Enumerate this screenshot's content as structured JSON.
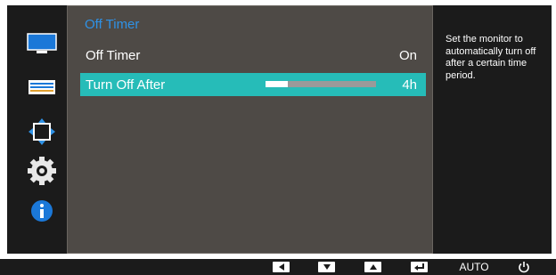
{
  "menu": {
    "title": "Off Timer",
    "rows": [
      {
        "label": "Off Timer",
        "value": "On",
        "selected": false
      },
      {
        "label": "Turn Off After",
        "value": "4h",
        "selected": true,
        "slider_fraction": 0.2
      }
    ]
  },
  "help": {
    "text": "Set the monitor to automatically turn off after a certain time period."
  },
  "sidebar": {
    "items": [
      {
        "icon": "picture-monitor-icon"
      },
      {
        "icon": "onscreen-display-icon"
      },
      {
        "icon": "position-size-icon"
      },
      {
        "icon": "gear-icon"
      },
      {
        "icon": "info-icon"
      }
    ]
  },
  "bottombar": {
    "buttons": [
      {
        "icon": "left-arrow-icon"
      },
      {
        "icon": "down-arrow-icon"
      },
      {
        "icon": "up-arrow-icon"
      },
      {
        "icon": "enter-icon"
      },
      {
        "label": "AUTO"
      },
      {
        "icon": "power-icon"
      }
    ]
  },
  "colors": {
    "accent": "#26bcb8",
    "title": "#2f92e6",
    "panel": "#4e4a46",
    "background": "#1b1b1b"
  }
}
